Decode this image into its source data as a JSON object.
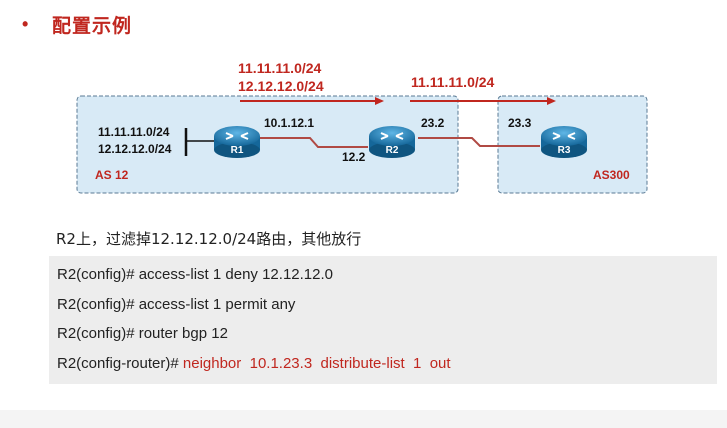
{
  "slide": {
    "bullet": "•",
    "title": "配置示例"
  },
  "diagram": {
    "route_labels": {
      "left_line1": "11.11.11.0/24",
      "left_line2": "12.12.12.0/24",
      "right": "11.11.11.0/24"
    },
    "r1_networks": [
      "11.11.11.0/24",
      "12.12.12.0/24"
    ],
    "link_labels": {
      "r1_r2_top": "10.1.12.1",
      "r1_r2_bottom": "12.2",
      "r2_r3_left": "23.2",
      "r2_r3_right": "23.3"
    },
    "routers": [
      "R1",
      "R2",
      "R3"
    ],
    "as_labels": {
      "left": "AS 12",
      "right": "AS300"
    },
    "colors": {
      "as_box_fill": "#d8eaf6",
      "as_box_border": "#5a7a94",
      "link": "#b04a44",
      "arrow": "#c0271f",
      "router": "#1c7fb5"
    }
  },
  "description": "R2上，过滤掉12.12.12.0/24路由，其他放行",
  "commands": [
    {
      "prompt": "R2(config)# ",
      "text": "access-list 1 deny 12.12.12.0",
      "highlight": ""
    },
    {
      "prompt": "R2(config)# ",
      "text": "access-list 1 permit any",
      "highlight": ""
    },
    {
      "prompt": "R2(config)# ",
      "text": "router bgp 12",
      "highlight": ""
    },
    {
      "prompt": "R2(config-router)# ",
      "text": "",
      "highlight": "neighbor  10.1.23.3  distribute-list  1  out"
    }
  ]
}
